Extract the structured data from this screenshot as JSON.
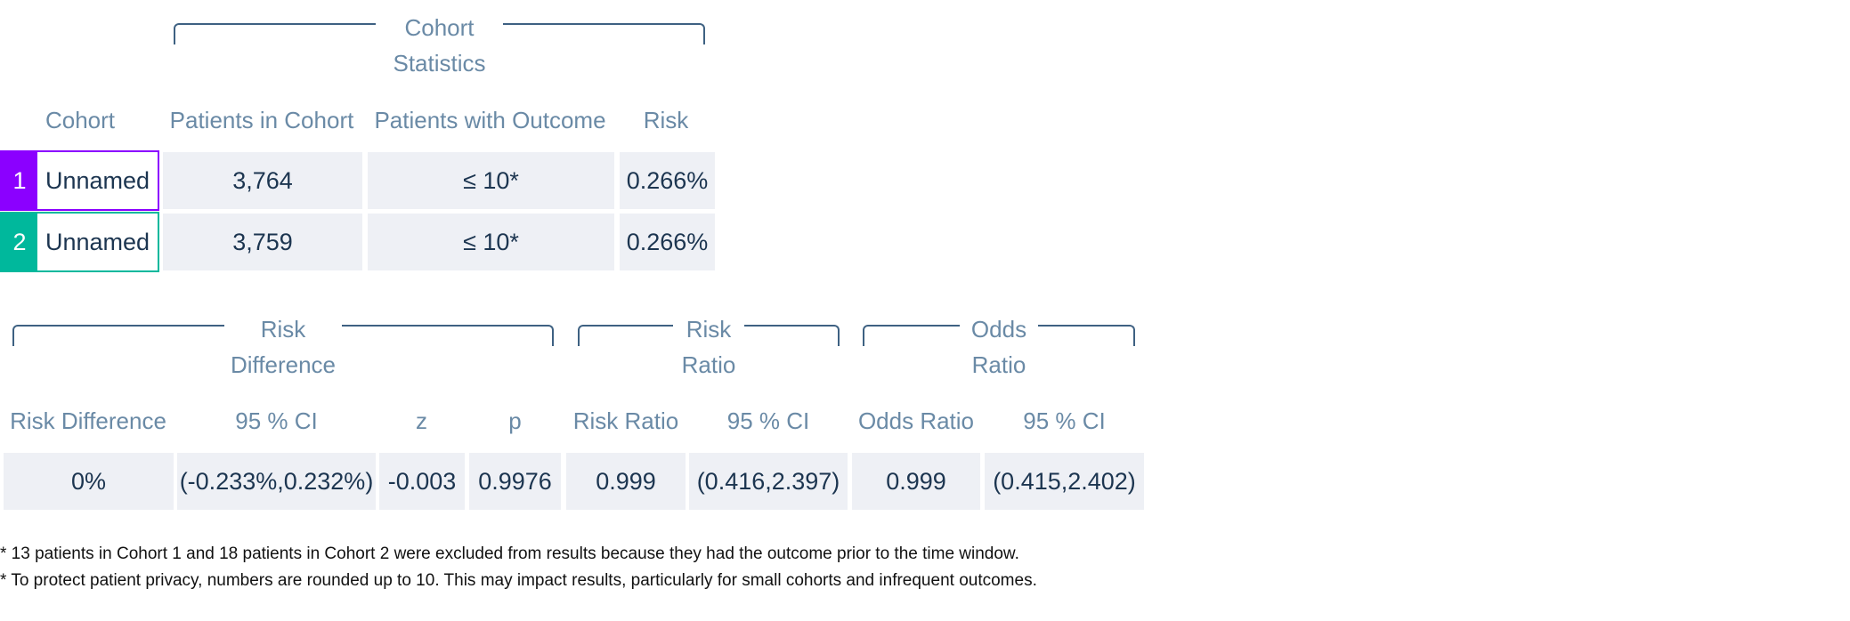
{
  "cohort_statistics": {
    "group_title": [
      "Cohort",
      "Statistics"
    ],
    "headers": [
      "Cohort",
      "Patients in Cohort",
      "Patients with Outcome",
      "Risk"
    ],
    "rows": [
      {
        "number": "1",
        "name": "Unnamed",
        "patients": "3,764",
        "outcome": "≤ 10*",
        "risk": "0.266%",
        "color": "#8b00ff"
      },
      {
        "number": "2",
        "name": "Unnamed",
        "patients": "3,759",
        "outcome": "≤ 10*",
        "risk": "0.266%",
        "color": "#00b89c"
      }
    ]
  },
  "measures": {
    "groups": [
      {
        "title": [
          "Risk",
          "Difference"
        ]
      },
      {
        "title": [
          "Risk",
          "Ratio"
        ]
      },
      {
        "title": [
          "Odds",
          "Ratio"
        ]
      }
    ],
    "headers": [
      "Risk Difference",
      "95 % CI",
      "z",
      "p",
      "Risk Ratio",
      "95 % CI",
      "Odds Ratio",
      "95 % CI"
    ],
    "values": [
      "0%",
      "(-0.233%,0.232%)",
      "-0.003",
      "0.9976",
      "0.999",
      "(0.416,2.397)",
      "0.999",
      "(0.415,2.402)"
    ]
  },
  "notes": [
    "* 13 patients in Cohort 1 and 18 patients in Cohort 2 were excluded from results because they had the outcome prior to the time window.",
    "* To protect patient privacy, numbers are rounded up to 10. This may impact results, particularly for small cohorts and infrequent outcomes."
  ]
}
